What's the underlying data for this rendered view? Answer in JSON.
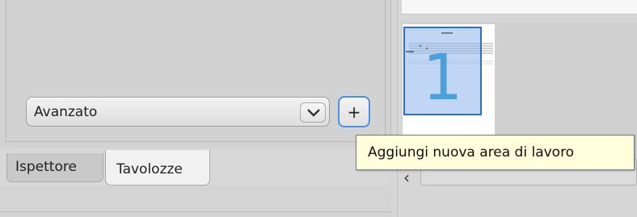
{
  "palette_panel": {
    "workspace_combo": {
      "selected_value": "Avanzato"
    },
    "add_workspace_button": {
      "glyph": "+"
    }
  },
  "tabs": [
    {
      "label": "Ispettore",
      "active": false
    },
    {
      "label": "Tavolozze",
      "active": true
    }
  ],
  "navigator": {
    "page_number": "1"
  },
  "tooltip": {
    "text": "Aggiungi nuova area di lavoro"
  },
  "icons": {
    "combo_arrow": "chevron-down-icon",
    "scroll_left": "chevron-left-icon"
  },
  "colors": {
    "focus_border": "#4e8fd9",
    "page_highlight": "#2f6fc8",
    "tooltip_bg": "#ffffdc"
  }
}
